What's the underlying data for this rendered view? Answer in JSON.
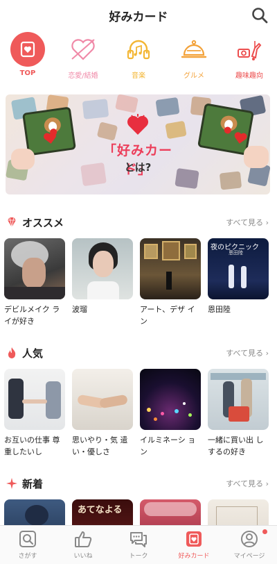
{
  "header": {
    "title": "好みカード"
  },
  "categories": [
    {
      "label": "TOP",
      "icon": "card-heart-icon",
      "color": "#ef5a5a"
    },
    {
      "label": "恋愛/結婚",
      "icon": "heart-arrow-icon",
      "color": "#f08aa8"
    },
    {
      "label": "音楽",
      "icon": "headphones-icon",
      "color": "#f3b634"
    },
    {
      "label": "グルメ",
      "icon": "cloche-icon",
      "color": "#f3a23a"
    },
    {
      "label": "趣味趣向",
      "icon": "hobby-icon",
      "color": "#ec4d4d"
    }
  ],
  "banner": {
    "title": "「好みカード」",
    "subtitle": "とは?"
  },
  "sections": {
    "recommend": {
      "title": "オススメ",
      "more": "すべて見る",
      "items": [
        {
          "label": "デビルメイク ライが好き"
        },
        {
          "label": "波瑠"
        },
        {
          "label": "アート、デザ イン"
        },
        {
          "label": "恩田陸"
        }
      ]
    },
    "popular": {
      "title": "人気",
      "more": "すべて見る",
      "items": [
        {
          "label": "お互いの仕事 尊重したいし"
        },
        {
          "label": "思いやり・気 遣い・優しさ"
        },
        {
          "label": "イルミネーシ ョン"
        },
        {
          "label": "一緒に買い出 しするの好き"
        }
      ]
    },
    "new": {
      "title": "新着",
      "more": "すべて見る",
      "items": [
        {
          "label": ""
        },
        {
          "label": "あてなよる"
        },
        {
          "label": ""
        },
        {
          "label": ""
        }
      ]
    }
  },
  "bottom_nav": [
    {
      "label": "さがす",
      "icon": "search-icon"
    },
    {
      "label": "いいね",
      "icon": "thumbs-up-icon"
    },
    {
      "label": "トーク",
      "icon": "chat-icon"
    },
    {
      "label": "好みカード",
      "icon": "card-heart-icon",
      "active": true
    },
    {
      "label": "マイページ",
      "icon": "person-icon"
    }
  ],
  "colors": {
    "accent": "#ef5a5a",
    "muted": "#8a8a8a"
  }
}
